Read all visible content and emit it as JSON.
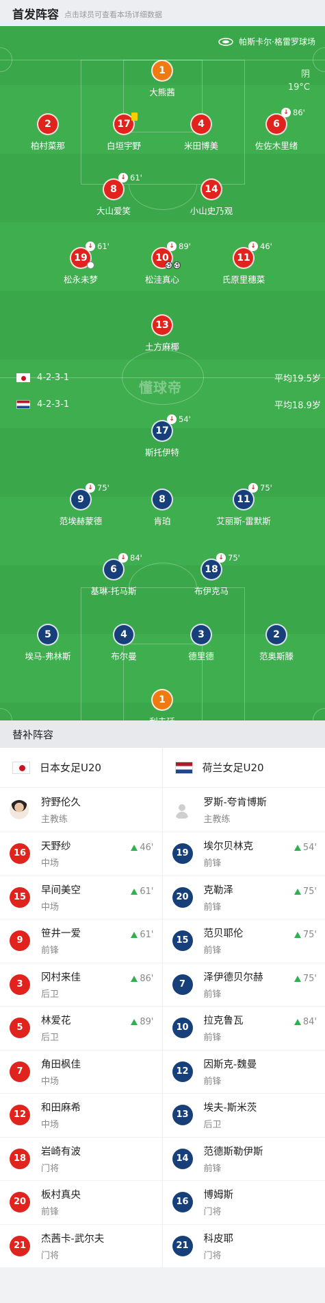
{
  "header": {
    "title": "首发阵容",
    "hint": "点击球员可查看本场详细数据"
  },
  "pitch": {
    "venue": "帕斯卡尔·格雷罗球场",
    "weather": "阴",
    "temperature": "19°C",
    "watermark": "懂球帝",
    "colors": {
      "home": "#e0231c",
      "home_keeper": "#f07a12",
      "away": "#173f7a",
      "away_keeper": "#f07a12",
      "grass": "#3aa84a"
    }
  },
  "home": {
    "formation": "4-2-3-1",
    "avg_age": "平均19.5岁",
    "players": {
      "gk": {
        "num": "1",
        "name": "大熊茜"
      },
      "d1": {
        "num": "2",
        "name": "柏村菜那"
      },
      "d2": {
        "num": "17",
        "name": "白垣宇野",
        "card": "yellow"
      },
      "d3": {
        "num": "4",
        "name": "米田博美"
      },
      "d4": {
        "num": "6",
        "name": "佐佐木里绪",
        "sub_off": "86'"
      },
      "m1": {
        "num": "8",
        "name": "大山爱笑",
        "sub_off": "61'"
      },
      "m2": {
        "num": "14",
        "name": "小山史乃观"
      },
      "a1": {
        "num": "19",
        "name": "松永未梦",
        "sub_off": "61'"
      },
      "a2": {
        "num": "10",
        "name": "松洼真心",
        "sub_off": "89'",
        "goals": 2
      },
      "a3": {
        "num": "11",
        "name": "氏原里穗菜",
        "sub_off": "46'"
      },
      "f1": {
        "num": "13",
        "name": "土方麻椰"
      }
    }
  },
  "away": {
    "formation": "4-2-3-1",
    "avg_age": "平均18.9岁",
    "players": {
      "f1": {
        "num": "17",
        "name": "斯托伊特",
        "sub_off": "54'"
      },
      "a1": {
        "num": "9",
        "name": "范埃赫蒙德",
        "sub_off": "75'"
      },
      "a2": {
        "num": "8",
        "name": "肯珀"
      },
      "a3": {
        "num": "11",
        "name": "艾丽斯-雷默斯",
        "sub_off": "75'"
      },
      "m1": {
        "num": "6",
        "name": "基琳-托马斯",
        "sub_off": "84'"
      },
      "m2": {
        "num": "18",
        "name": "布伊克马",
        "sub_off": "75'"
      },
      "d1": {
        "num": "5",
        "name": "埃马-弗林斯"
      },
      "d2": {
        "num": "4",
        "name": "布尔曼"
      },
      "d3": {
        "num": "3",
        "name": "德里德"
      },
      "d4": {
        "num": "2",
        "name": "范奥斯滕"
      },
      "gk": {
        "num": "1",
        "name": "利夫廷"
      }
    }
  },
  "subs": {
    "title": "替补阵容",
    "home": {
      "team_name": "日本女足U20",
      "coach": {
        "name": "狩野伦久",
        "role": "主教练"
      },
      "list": [
        {
          "num": "16",
          "name": "天野纱",
          "pos": "中场",
          "in": "46'"
        },
        {
          "num": "15",
          "name": "早间美空",
          "pos": "中场",
          "in": "61'"
        },
        {
          "num": "9",
          "name": "笹井一爱",
          "pos": "前锋",
          "in": "61'"
        },
        {
          "num": "3",
          "name": "冈村来佳",
          "pos": "后卫",
          "in": "86'"
        },
        {
          "num": "5",
          "name": "林爱花",
          "pos": "后卫",
          "in": "89'"
        },
        {
          "num": "7",
          "name": "角田枫佳",
          "pos": "中场",
          "in": ""
        },
        {
          "num": "12",
          "name": "和田麻希",
          "pos": "中场",
          "in": ""
        },
        {
          "num": "18",
          "name": "岩崎有波",
          "pos": "门将",
          "in": ""
        },
        {
          "num": "20",
          "name": "板村真央",
          "pos": "前锋",
          "in": ""
        },
        {
          "num": "21",
          "name": "杰茜卡-武尔夫",
          "pos": "门将",
          "in": ""
        }
      ]
    },
    "away": {
      "team_name": "荷兰女足U20",
      "coach": {
        "name": "罗斯-夸肯博斯",
        "role": "主教练"
      },
      "list": [
        {
          "num": "19",
          "name": "埃尔贝林克",
          "pos": "前锋",
          "in": "54'"
        },
        {
          "num": "20",
          "name": "克勒泽",
          "pos": "前锋",
          "in": "75'"
        },
        {
          "num": "15",
          "name": "范贝耶伦",
          "pos": "前锋",
          "in": "75'"
        },
        {
          "num": "7",
          "name": "泽伊德贝尔赫",
          "pos": "前锋",
          "in": "75'"
        },
        {
          "num": "10",
          "name": "拉克鲁瓦",
          "pos": "前锋",
          "in": "84'"
        },
        {
          "num": "12",
          "name": "因斯克-魏曼",
          "pos": "前锋",
          "in": ""
        },
        {
          "num": "13",
          "name": "埃夫-斯米茨",
          "pos": "后卫",
          "in": ""
        },
        {
          "num": "14",
          "name": "范德斯勒伊斯",
          "pos": "前锋",
          "in": ""
        },
        {
          "num": "16",
          "name": "博姆斯",
          "pos": "门将",
          "in": ""
        },
        {
          "num": "21",
          "name": "科皮耶",
          "pos": "门将",
          "in": ""
        }
      ]
    }
  }
}
